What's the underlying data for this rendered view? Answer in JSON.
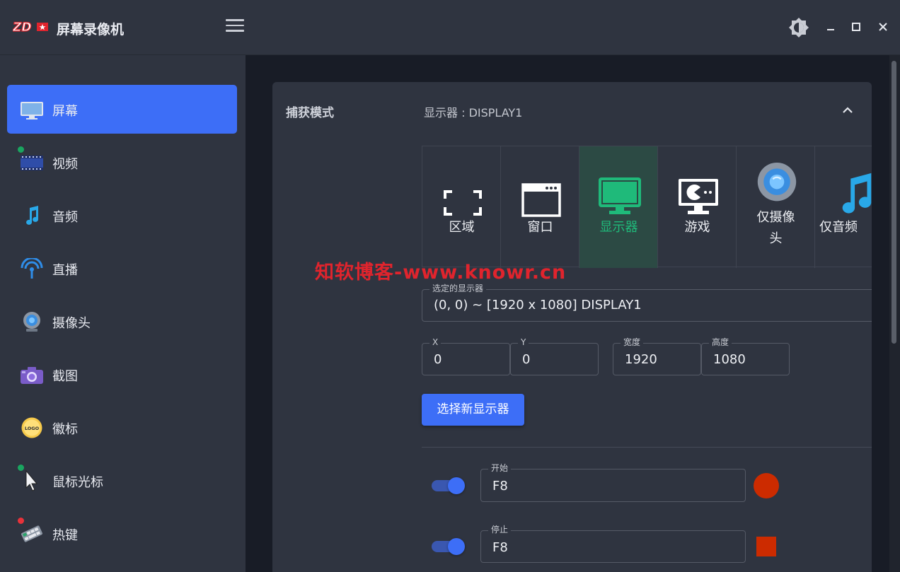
{
  "app": {
    "title": "屏幕录像机",
    "logo_text": "ZD"
  },
  "sidebar": {
    "items": [
      {
        "label": "屏幕",
        "icon": "monitor-icon",
        "active": true
      },
      {
        "label": "视频",
        "icon": "film-icon",
        "status_dot": "#1aa560"
      },
      {
        "label": "音频",
        "icon": "music-note-icon"
      },
      {
        "label": "直播",
        "icon": "broadcast-icon"
      },
      {
        "label": "摄像头",
        "icon": "webcam-icon"
      },
      {
        "label": "截图",
        "icon": "camera-icon"
      },
      {
        "label": "徽标",
        "icon": "logo-badge-icon",
        "badge_text": "LOGO"
      },
      {
        "label": "鼠标光标",
        "icon": "cursor-icon",
        "status_dot": "#1aa560"
      },
      {
        "label": "热键",
        "icon": "keyboard-icon",
        "status_dot": "#e8323a"
      }
    ]
  },
  "capture": {
    "title": "捕获模式",
    "summary": "显示器 : DISPLAY1",
    "modes": [
      {
        "label": "区域",
        "icon": "region-icon"
      },
      {
        "label": "窗口",
        "icon": "window-icon"
      },
      {
        "label": "显示器",
        "icon": "monitor-icon",
        "active": true
      },
      {
        "label": "游戏",
        "icon": "game-icon"
      },
      {
        "label": "仅摄像\n头",
        "icon": "webcam-icon"
      },
      {
        "label": "仅音频",
        "icon": "music-note-icon"
      }
    ],
    "selected_display": {
      "label": "选定的显示器",
      "value": "(0, 0) ~ [1920 x 1080] DISPLAY1"
    },
    "x": {
      "label": "X",
      "value": "0"
    },
    "y": {
      "label": "Y",
      "value": "0"
    },
    "width": {
      "label": "宽度",
      "value": "1920"
    },
    "height": {
      "label": "高度",
      "value": "1080"
    },
    "select_button": "选择新显示器"
  },
  "hotkeys": {
    "start": {
      "label": "开始",
      "value": "F8",
      "enabled": true
    },
    "stop": {
      "label": "停止",
      "value": "F8",
      "enabled": true
    }
  },
  "watermark": "知软博客-www.knowr.cn",
  "colors": {
    "accent": "#3d6ef7",
    "active_mode": "#1fba7a",
    "record": "#cc2b00",
    "background": "#181c26",
    "panel": "#2f3440"
  }
}
